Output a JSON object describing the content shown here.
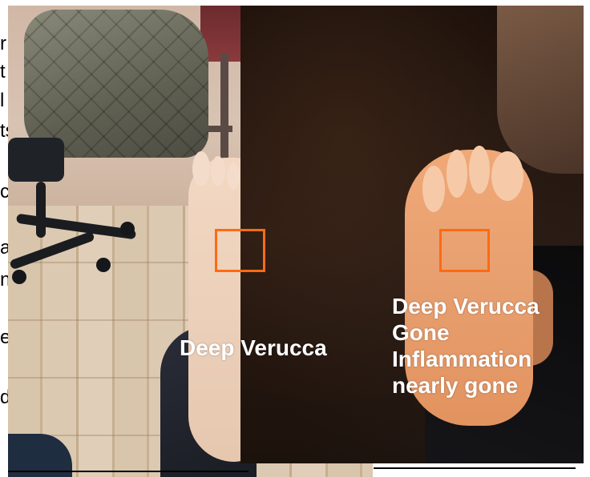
{
  "captions": {
    "left": "Deep Verucca",
    "right": [
      "Deep Verucca",
      "Gone",
      "Inflammation",
      "nearly gone"
    ]
  },
  "background_fragments": [
    "r",
    "t",
    "l",
    "ts",
    "c",
    "a",
    "n",
    "e",
    "d"
  ],
  "colors": {
    "marker": "#ff6a12",
    "caption_text": "#ffffff",
    "page_background": "#ffffff"
  }
}
